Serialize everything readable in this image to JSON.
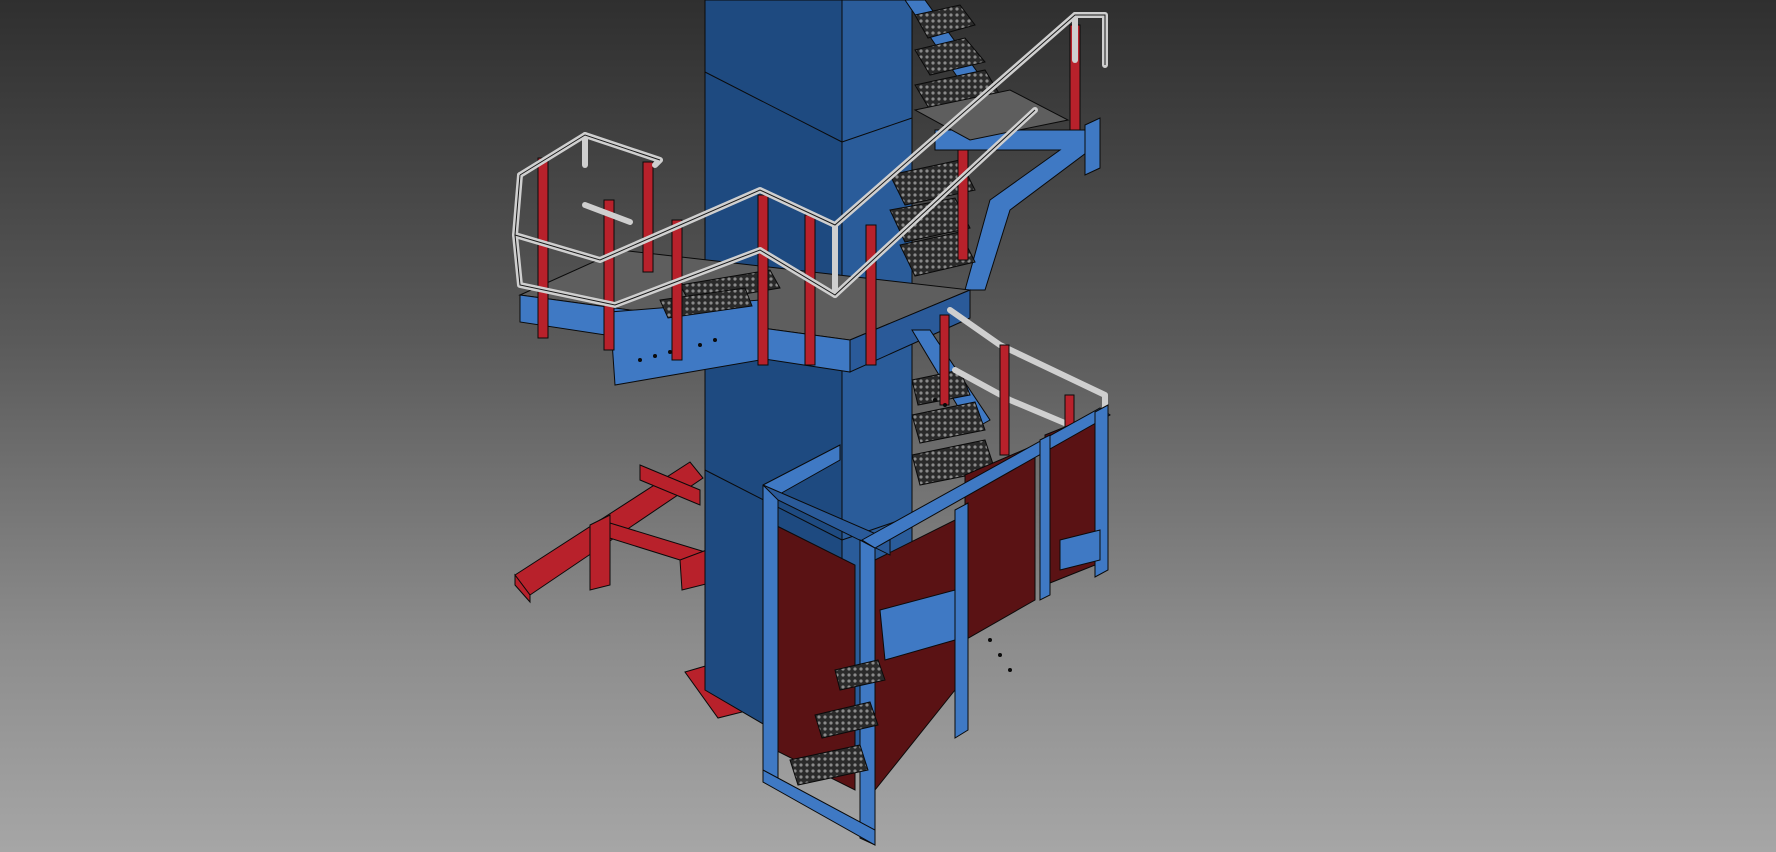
{
  "viewport": {
    "background_top": "#2f2f2f",
    "background_bottom": "#a6a6a6"
  },
  "model": {
    "colors": {
      "column_blue": "#1e4a80",
      "column_blue_light": "#2a5c9a",
      "steel_blue": "#3f79c4",
      "steel_blue_dark": "#2a5a99",
      "beam_red": "#b8212b",
      "panel_red": "#5a1214",
      "handrail": "#cfcfcf",
      "grating": "#2a2a2a",
      "landing_grey": "#5e5e5e",
      "outline": "#0a0a0a"
    }
  }
}
